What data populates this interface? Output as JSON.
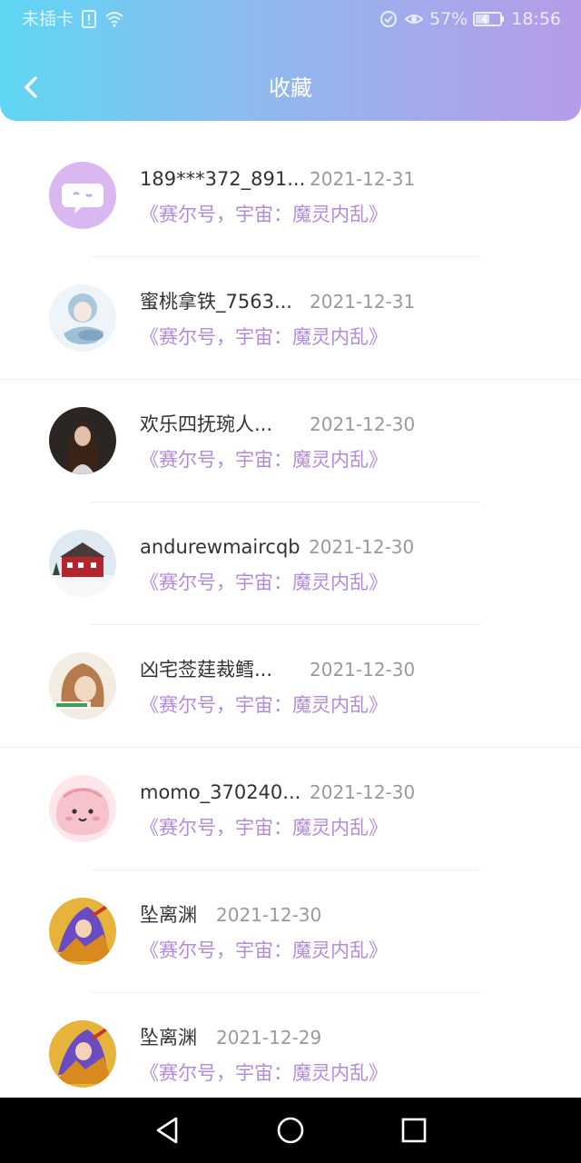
{
  "status_bar": {
    "carrier": "未插卡",
    "battery": "57%",
    "time": "18:56"
  },
  "header": {
    "title": "收藏"
  },
  "colors": {
    "accent": "#b38bd9",
    "gradient_start": "#5fd6f3",
    "gradient_end": "#b79be8"
  },
  "items": [
    {
      "name": "189***372_891...",
      "date": "2021-12-31",
      "work": "《赛尔号，宇宙：魔灵内乱》",
      "avatar": "chat-bubble-avatar"
    },
    {
      "name": "蜜桃拿铁_7563...",
      "date": "2021-12-31",
      "work": "《赛尔号，宇宙：魔灵内乱》",
      "avatar": "anime-girl-avatar"
    },
    {
      "name": "欢乐四抚琬人...",
      "date": "2021-12-30",
      "work": "《赛尔号，宇宙：魔灵内乱》",
      "avatar": "woman-photo-avatar"
    },
    {
      "name": "andurewmaircqb",
      "date": "2021-12-30",
      "work": "《赛尔号，宇宙：魔灵内乱》",
      "avatar": "red-house-avatar"
    },
    {
      "name": "凶宅莶莛裁鳕...",
      "date": "2021-12-30",
      "work": "《赛尔号，宇宙：魔灵内乱》",
      "avatar": "brown-hair-avatar"
    },
    {
      "name": "momo_370240...",
      "date": "2021-12-30",
      "work": "《赛尔号，宇宙：魔灵内乱》",
      "avatar": "pink-blob-avatar"
    },
    {
      "name": "坠离渊",
      "date": "2021-12-30",
      "work": "《赛尔号，宇宙：魔灵内乱》",
      "avatar": "anime-warrior-avatar"
    },
    {
      "name": "坠离渊",
      "date": "2021-12-29",
      "work": "《赛尔号，宇宙：魔灵内乱》",
      "avatar": "anime-warrior-avatar"
    }
  ]
}
